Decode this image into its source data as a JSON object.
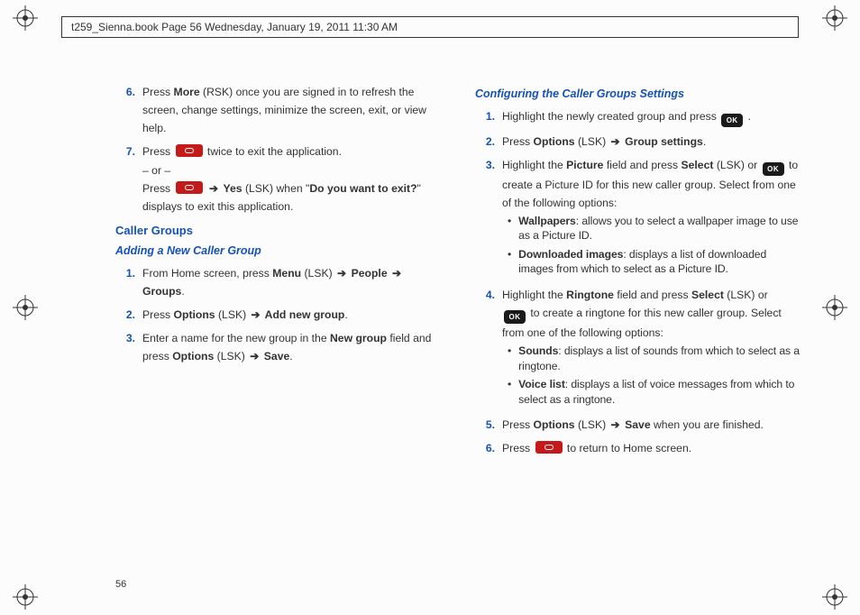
{
  "header": "t259_Sienna.book  Page 56  Wednesday, January 19, 2011  11:30 AM",
  "page_number": "56",
  "left": {
    "step6_num": "6.",
    "step6_a": "Press ",
    "step6_b": "More",
    "step6_c": " (RSK) once you are signed in to refresh the screen, change settings, minimize the screen, exit, or view help.",
    "step7_num": "7.",
    "step7_a": "Press  ",
    "step7_b": "  twice to exit the application.",
    "step7_or": "– or –",
    "step7_c": "Press  ",
    "step7_d": "  ",
    "step7_arrow": "➔",
    "step7_e": " ",
    "step7_yes": "Yes",
    "step7_f": " (LSK) when \"",
    "step7_g": "Do you want to exit?",
    "step7_h": "\" displays to exit this application.",
    "h2": "Caller Groups",
    "h3": "Adding a New Caller Group",
    "a1_num": "1.",
    "a1_a": "From Home screen, press ",
    "a1_menu": "Menu",
    "a1_b": " (LSK) ",
    "a1_arr1": "➔",
    "a1_people": " People ",
    "a1_arr2": "➔",
    "a1_groups": " Groups",
    "a2_num": "2.",
    "a2_a": "Press ",
    "a2_opt": "Options",
    "a2_b": " (LSK) ",
    "a2_arr": "➔",
    "a2_add": " Add new group",
    "a3_num": "3.",
    "a3_a": "Enter a name for the new group in the ",
    "a3_b": "New group",
    "a3_c": " field and press ",
    "a3_opt": "Options",
    "a3_d": " (LSK) ",
    "a3_arr": "➔",
    "a3_save": " Save"
  },
  "right": {
    "h3": "Configuring the Caller Groups Settings",
    "c1_num": "1.",
    "c1_a": "Highlight the newly created group and press  ",
    "c1_b": " .",
    "c2_num": "2.",
    "c2_a": "Press ",
    "c2_opt": "Options",
    "c2_b": " (LSK) ",
    "c2_arr": "➔",
    "c2_gs": " Group settings",
    "c3_num": "3.",
    "c3_a": "Highlight the ",
    "c3_pic": "Picture",
    "c3_b": " field and press ",
    "c3_sel": "Select",
    "c3_c": " (LSK) or  ",
    "c3_d": "  to create a Picture ID for this new caller group. Select from one of the following options:",
    "c3_bul1a": "Wallpapers",
    "c3_bul1b": ": allows you to select a wallpaper image to use as a Picture ID.",
    "c3_bul2a": "Downloaded images",
    "c3_bul2b": ": displays a list of downloaded images from which to select as a Picture ID.",
    "c4_num": "4.",
    "c4_a": "Highlight the ",
    "c4_ring": "Ringtone",
    "c4_b": " field and press ",
    "c4_sel": "Select",
    "c4_c": " (LSK) or ",
    "c4_d": "  to create a ringtone for this new caller group. Select from one of the following options:",
    "c4_bul1a": "Sounds",
    "c4_bul1b": ": displays a list of sounds from which to select as a ringtone.",
    "c4_bul2a": "Voice list",
    "c4_bul2b": ": displays a list of voice messages from which to select as a ringtone.",
    "c5_num": "5.",
    "c5_a": "Press ",
    "c5_opt": "Options",
    "c5_b": " (LSK) ",
    "c5_arr": "➔",
    "c5_save": " Save",
    "c5_c": " when you are finished.",
    "c6_num": "6.",
    "c6_a": "Press  ",
    "c6_b": "  to return to Home screen."
  },
  "ok_label": "OK"
}
